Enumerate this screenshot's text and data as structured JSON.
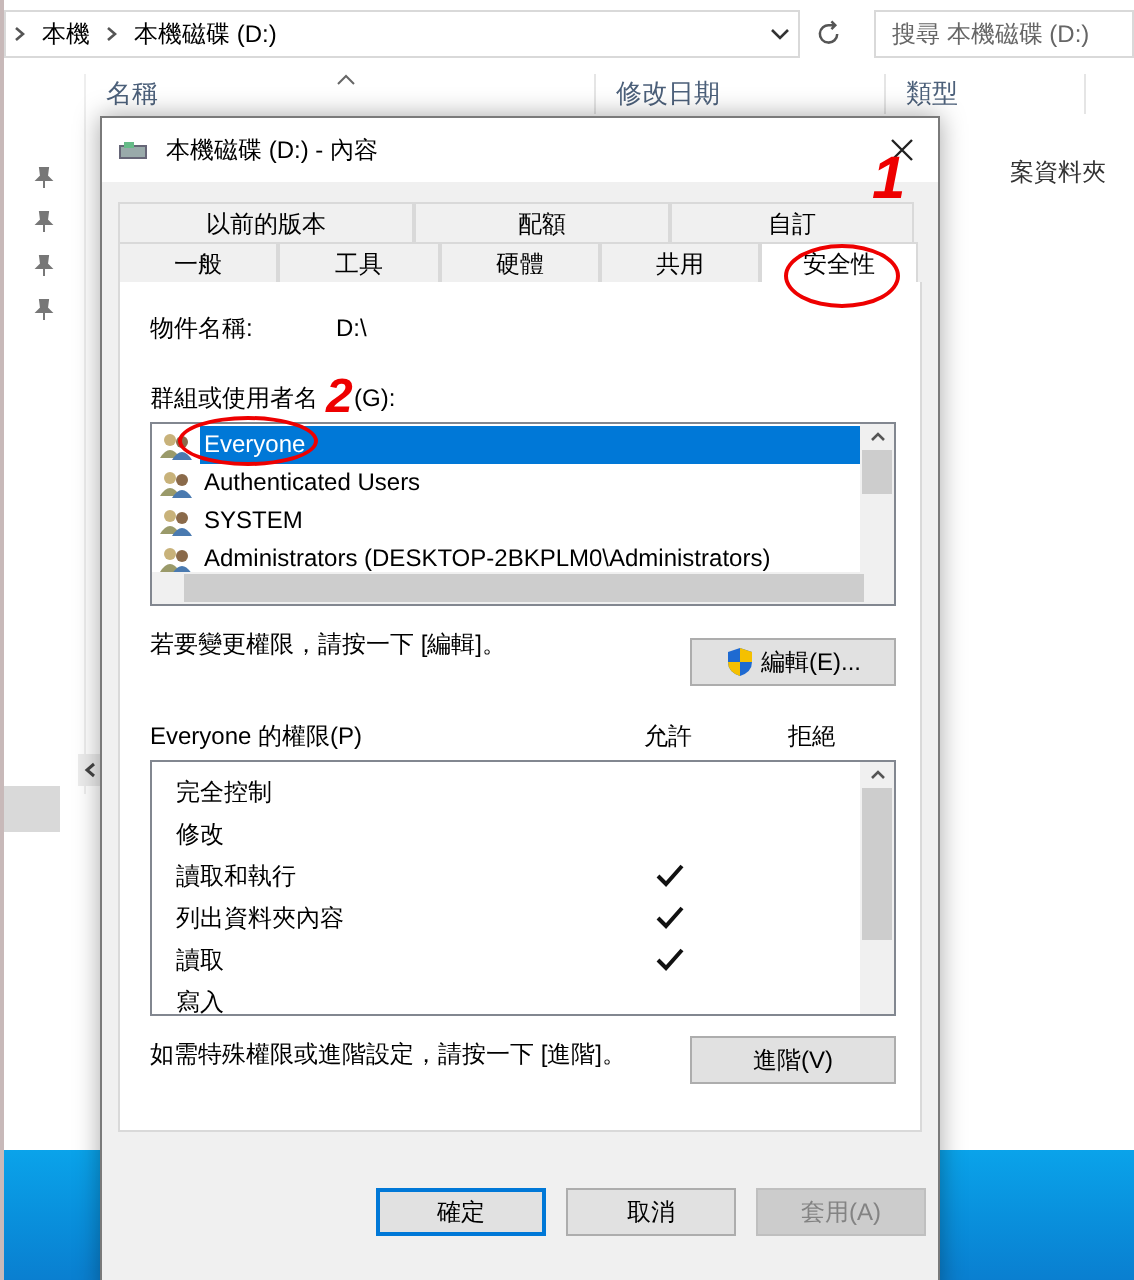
{
  "explorer": {
    "breadcrumb": [
      "本機",
      "本機磁碟 (D:)"
    ],
    "search": {
      "placeholder": "搜尋 本機磁碟 (D:)"
    },
    "columns": [
      "名稱",
      "修改日期",
      "類型"
    ],
    "row_type": "案資料夾"
  },
  "dialog": {
    "title": "本機磁碟 (D:) - 內容",
    "tab_rows": [
      [
        {
          "label": "以前的版本",
          "selected": false
        },
        {
          "label": "配額",
          "selected": false
        },
        {
          "label": "自訂",
          "selected": false
        }
      ],
      [
        {
          "label": "一般",
          "selected": false
        },
        {
          "label": "工具",
          "selected": false
        },
        {
          "label": "硬體",
          "selected": false
        },
        {
          "label": "共用",
          "selected": false
        },
        {
          "label": "安全性",
          "selected": true
        }
      ]
    ],
    "object_name": {
      "label": "物件名稱:",
      "value": "D:\\"
    },
    "groups_label": "群組或使用者名",
    "groups_label_suffix": "(G):",
    "users": [
      {
        "name": "Everyone",
        "selected": true
      },
      {
        "name": "Authenticated Users",
        "selected": false
      },
      {
        "name": "SYSTEM",
        "selected": false
      },
      {
        "name": "Administrators (DESKTOP-2BKPLM0\\Administrators)",
        "selected": false
      }
    ],
    "edit_hint": "若要變更權限，請按一下 [編輯]。",
    "edit_button": "編輯(E)...",
    "permissions_label": "Everyone 的權限(P)",
    "allow_label": "允許",
    "deny_label": "拒絕",
    "permissions": [
      {
        "name": "完全控制",
        "allow": false,
        "deny": false
      },
      {
        "name": "修改",
        "allow": false,
        "deny": false
      },
      {
        "name": "讀取和執行",
        "allow": true,
        "deny": false
      },
      {
        "name": "列出資料夾內容",
        "allow": true,
        "deny": false
      },
      {
        "name": "讀取",
        "allow": true,
        "deny": false
      },
      {
        "name": "寫入",
        "allow": false,
        "deny": false
      }
    ],
    "advanced_hint": "如需特殊權限或進階設定，請按一下 [進階]。",
    "advanced_button": "進階(V)",
    "buttons": [
      {
        "label": "確定",
        "kind": "default",
        "disabled": false
      },
      {
        "label": "取消",
        "kind": "normal",
        "disabled": false
      },
      {
        "label": "套用(A)",
        "kind": "normal",
        "disabled": true
      }
    ]
  },
  "annotations": [
    {
      "label": "1"
    },
    {
      "label": "2"
    }
  ]
}
